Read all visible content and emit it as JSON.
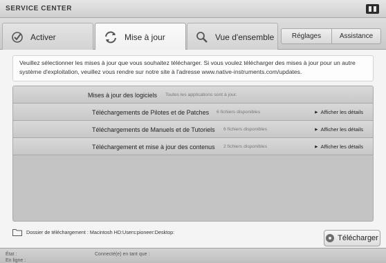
{
  "window": {
    "title": "SERVICE CENTER"
  },
  "tabs": [
    {
      "label": "Activer",
      "icon": "check-circle-icon",
      "active": false
    },
    {
      "label": "Mise à jour",
      "icon": "refresh-icon",
      "active": true
    },
    {
      "label": "Vue d'ensemble",
      "icon": "magnifier-icon",
      "active": false
    }
  ],
  "toolbar": {
    "reglages_label": "Réglages",
    "assistance_label": "Assistance"
  },
  "info": {
    "text": "Veuillez sélectionner les mises à jour que vous souhaitez télécharger. Si vous voulez télécharger des mises à jour pour un autre système d'exploitation, veuillez vous rendre sur notre site à l'adresse www.native-instruments.com/updates."
  },
  "rows": [
    {
      "title": "Mises à jour des logiciels",
      "subtitle": "Toutes les applications sont à jour.",
      "details": ""
    },
    {
      "title": "Téléchargements de Pilotes et de Patches",
      "subtitle": "6 fichiers disponibles",
      "details": "Afficher les détails"
    },
    {
      "title": "Téléchargements de Manuels et de Tutoriels",
      "subtitle": "6 fichiers disponibles",
      "details": "Afficher les détails"
    },
    {
      "title": "Téléchargement et mise à jour des contenus",
      "subtitle": "2 fichiers disponibles",
      "details": "Afficher les détails"
    }
  ],
  "folder": {
    "label": "Dossier de téléchargement : Macintosh HD:Users:pioneer:Desktop:"
  },
  "download_button": {
    "label": "Télécharger"
  },
  "status": {
    "state_label": "État :",
    "online_label": "En ligne :",
    "connected_label": "Connecté(e) en tant que :"
  },
  "colors": {
    "background": "#bdbdbd",
    "panel": "#f4f4f4",
    "row": "#d0d0d0"
  }
}
